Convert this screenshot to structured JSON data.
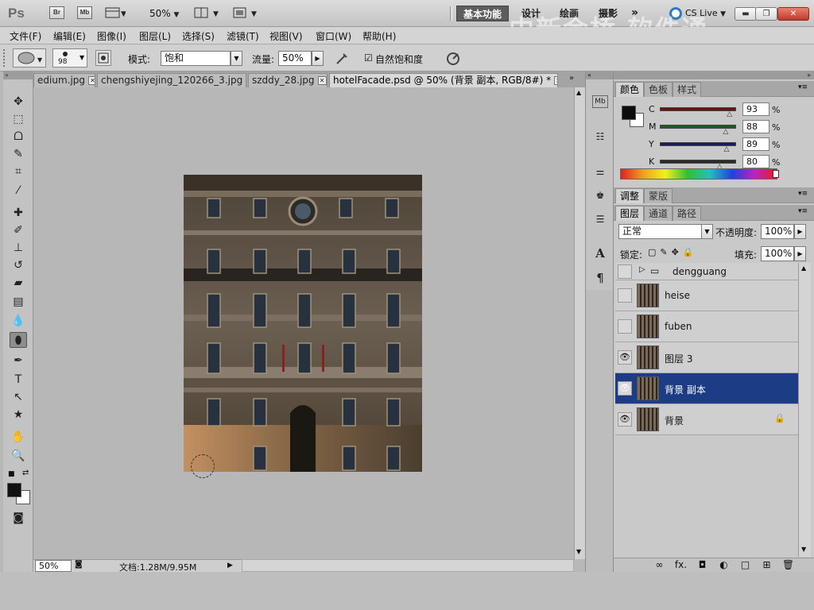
{
  "appbar": {
    "logo": "Ps",
    "bridge": "Br",
    "minibridge": "Mb",
    "zoom": "50%",
    "workspaces": [
      "基本功能",
      "设计",
      "绘画",
      "摄影"
    ],
    "more": "»",
    "cslive": "CS Live"
  },
  "watermark": "中新金桥 软件通",
  "menus": [
    "文件(F)",
    "编辑(E)",
    "图像(I)",
    "图层(L)",
    "选择(S)",
    "滤镜(T)",
    "视图(V)",
    "窗口(W)",
    "帮助(H)"
  ],
  "options": {
    "brush_size": "98",
    "mode_label": "模式:",
    "mode_value": "饱和",
    "flow_label": "流量:",
    "flow_value": "50%",
    "vibrance_check": "☑",
    "vibrance_label": "自然饱和度"
  },
  "tabs": [
    {
      "label": "edium.jpg",
      "close": "✕"
    },
    {
      "label": "chengshiyejing_120266_3.jpg",
      "close": "✕"
    },
    {
      "label": "szddy_28.jpg",
      "close": "✕"
    },
    {
      "label": "hotelFacade.psd @ 50% (背景 副本, RGB/8#) *",
      "close": "✕"
    }
  ],
  "status": {
    "zoom": "50%",
    "doc": "文档:1.28M/9.95M"
  },
  "color_panel": {
    "tabs": [
      "颜色",
      "色板",
      "样式"
    ],
    "channels": [
      {
        "label": "C",
        "value": "93",
        "pct": "%",
        "color": "#6b1111",
        "level": 0.93
      },
      {
        "label": "M",
        "value": "88",
        "pct": "%",
        "color": "#1a5c1a",
        "level": 0.88
      },
      {
        "label": "Y",
        "value": "89",
        "pct": "%",
        "color": "#1a1a5c",
        "level": 0.89
      },
      {
        "label": "K",
        "value": "80",
        "pct": "%",
        "color": "#2a2a2a",
        "level": 0.8
      }
    ]
  },
  "adjust_panel": {
    "tabs": [
      "调整",
      "蒙版"
    ]
  },
  "layers_panel": {
    "tabs": [
      "图层",
      "通道",
      "路径"
    ],
    "blend": "正常",
    "opacity_label": "不透明度:",
    "opacity": "100%",
    "lock_label": "锁定:",
    "fill_label": "填充:",
    "fill": "100%",
    "group": "dengguang",
    "layers": [
      {
        "name": "heise",
        "visible": "",
        "selected": false
      },
      {
        "name": "fuben",
        "visible": "",
        "selected": false
      },
      {
        "name": "图层 3",
        "visible": "👁",
        "selected": false
      },
      {
        "name": "背景 副本",
        "visible": "👁",
        "selected": true
      },
      {
        "name": "背景",
        "visible": "👁",
        "selected": false
      }
    ],
    "lock_icon": "🔒",
    "bottom_icons": [
      "∞",
      "fx.",
      "◘",
      "◐",
      "□",
      "⊞",
      "🗑"
    ]
  }
}
